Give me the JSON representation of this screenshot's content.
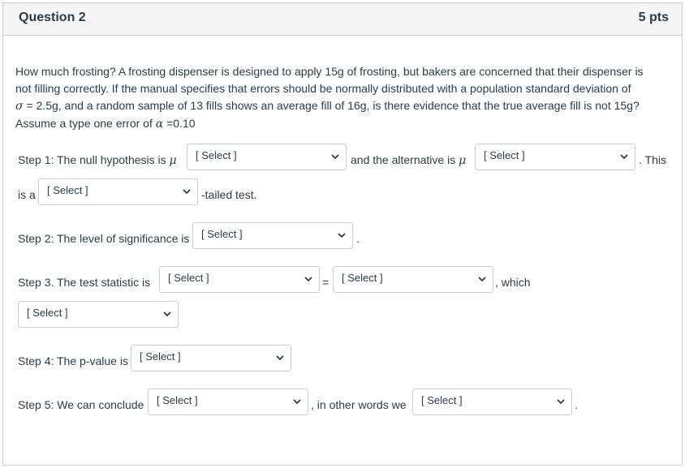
{
  "question": {
    "title": "Question 2",
    "points": "5 pts"
  },
  "prompt": {
    "line1": "How much frosting? A frosting dispenser is designed to apply 15g of frosting, but bakers are concerned that their dispenser is",
    "line2": "not filling correctly. If the manual specifies that errors should be normally distributed with a population standard deviation of",
    "line3_sigma": "σ",
    "line3_rest": " = 2.5g, and a random sample of 13 fills shows an average fill of 16g, is there evidence that the true average fill is not 15g?",
    "line4_pre": "Assume a type one error of ",
    "line4_alpha": "α",
    "line4_rest": " =0.10"
  },
  "symbols": {
    "mu": "μ"
  },
  "steps": {
    "step1_text": "Step 1: The null hypothesis is",
    "step1_mid": "and the alternative is",
    "step1_end": ". This",
    "step1b_pre": "is a",
    "step1b_post": "-tailed test.",
    "step2_text": "Step 2: The level of significance is",
    "step2_end": ".",
    "step3_text": "Step 3.  The test statistic is",
    "step3_eq": "=",
    "step3_end": ", which",
    "step4_text": "Step 4: The p-value is",
    "step5_text": "Step 5: We can conclude",
    "step5_mid": ", in other words we",
    "step5_end": "."
  },
  "dropdowns": {
    "null_hypothesis": "[ Select ]",
    "alternative_hypothesis": "[ Select ]",
    "tail_type": "[ Select ]",
    "significance_level": "[ Select ]",
    "test_statistic_name": "[ Select ]",
    "test_statistic_value": "[ Select ]",
    "test_statistic_comparison": "[ Select ]",
    "p_value": "[ Select ]",
    "conclusion": "[ Select ]",
    "conclusion_words": "[ Select ]"
  },
  "icons": {
    "dropdown": "chevron-down-icon"
  }
}
